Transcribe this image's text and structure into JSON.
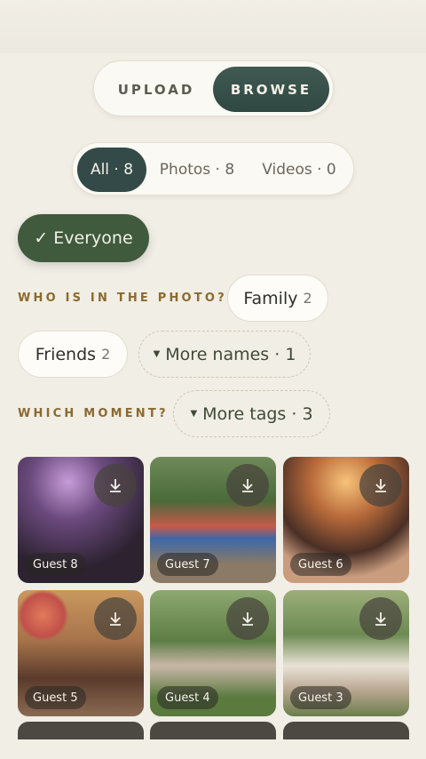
{
  "mode": {
    "upload": "UPLOAD",
    "browse": "BROWSE",
    "selected": "browse"
  },
  "filters": [
    {
      "label": "All · 8",
      "selected": true
    },
    {
      "label": "Photos · 8",
      "selected": false
    },
    {
      "label": "Videos · 0",
      "selected": false
    }
  ],
  "everyone": {
    "check": "✓",
    "label": "Everyone"
  },
  "people": {
    "heading": "WHO IS IN THE PHOTO?",
    "chips": [
      {
        "label": "Family",
        "count": "2"
      },
      {
        "label": "Friends",
        "count": "2"
      }
    ],
    "more": "More names · 1"
  },
  "moments": {
    "heading": "WHICH MOMENT?",
    "more": "More tags · 3"
  },
  "gallery": [
    {
      "guest": "Guest 8",
      "scene": "party"
    },
    {
      "guest": "Guest 7",
      "scene": "run"
    },
    {
      "guest": "Guest 6",
      "scene": "concert"
    },
    {
      "guest": "Guest 5",
      "scene": "cake"
    },
    {
      "guest": "Guest 4",
      "scene": "picnic"
    },
    {
      "guest": "Guest 3",
      "scene": "garden"
    }
  ],
  "icons": {
    "download": "download-icon",
    "caret": "caret-down-icon",
    "check": "check-icon"
  },
  "colors": {
    "accent_dark": "#344a48",
    "green": "#3f5a3c",
    "gold_label": "#8b6a2f",
    "background": "#f1eee6"
  }
}
